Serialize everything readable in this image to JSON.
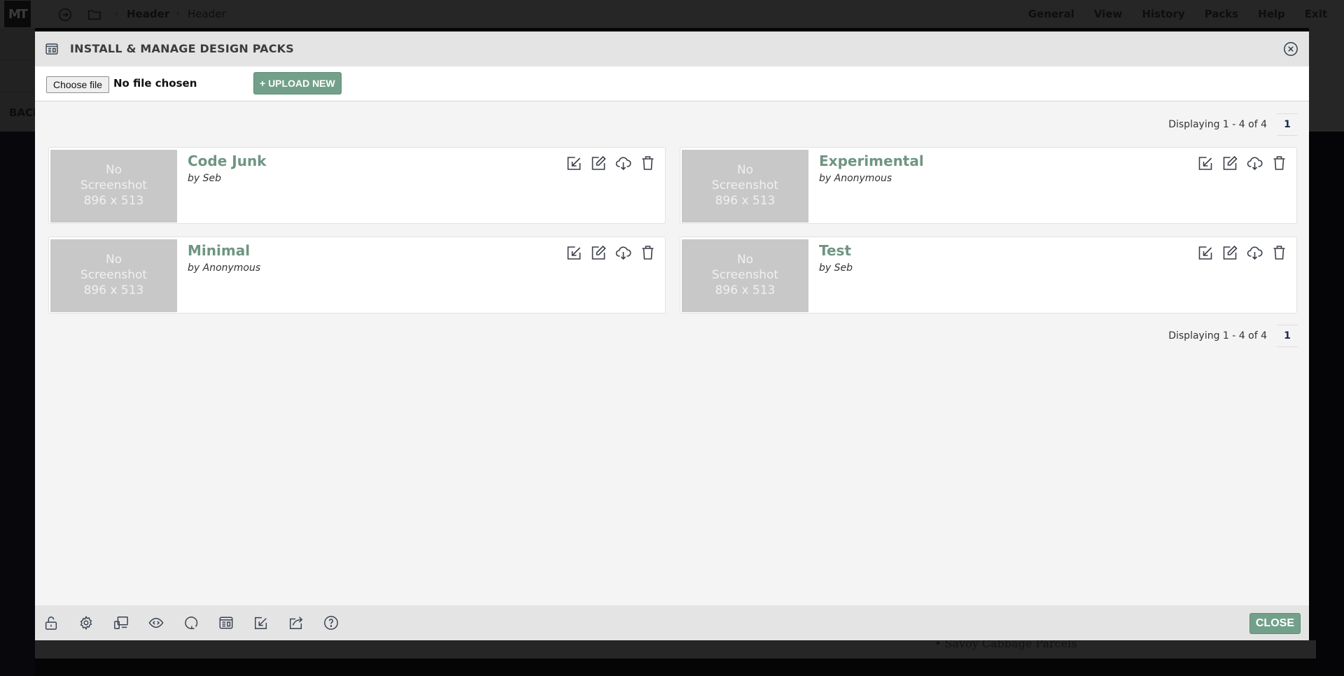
{
  "app": {
    "logo": "MT",
    "breadcrumb": [
      "Header",
      "Header"
    ],
    "menu": [
      "General",
      "View",
      "History",
      "Packs",
      "Help",
      "Exit"
    ],
    "side_label": "BACK",
    "background_list_item": "Savoy Cabbage Parcels"
  },
  "modal": {
    "title": "INSTALL & MANAGE DESIGN PACKS",
    "header_icon": "layout-panel-icon",
    "close_icon": "close-circle-icon",
    "upload": {
      "choose_file_label": "Choose file",
      "file_status": "No file chosen",
      "upload_button": "+ UPLOAD NEW"
    },
    "pagination": {
      "info": "Displaying 1 - 4 of 4",
      "current_page": "1"
    },
    "packs": [
      {
        "name": "Code Junk",
        "author": "by Seb",
        "thumb_line1": "No",
        "thumb_line2": "Screenshot",
        "thumb_line3": "896 x 513"
      },
      {
        "name": "Experimental",
        "author": "by Anonymous",
        "thumb_line1": "No",
        "thumb_line2": "Screenshot",
        "thumb_line3": "896 x 513"
      },
      {
        "name": "Minimal",
        "author": "by Anonymous",
        "thumb_line1": "No",
        "thumb_line2": "Screenshot",
        "thumb_line3": "896 x 513"
      },
      {
        "name": "Test",
        "author": "by Seb",
        "thumb_line1": "No",
        "thumb_line2": "Screenshot",
        "thumb_line3": "896 x 513"
      }
    ],
    "pack_actions": [
      "install-icon",
      "edit-icon",
      "download-cloud-icon",
      "trash-icon"
    ],
    "footer": {
      "tools": [
        "unlock-icon",
        "gear-icon",
        "devices-icon",
        "eye-code-icon",
        "refresh-icon",
        "layout-panel-icon",
        "install-icon",
        "export-icon",
        "help-icon"
      ],
      "close_button": "CLOSE"
    },
    "colors": {
      "accent": "#73a08a",
      "pack_name": "#6f9582",
      "header_bg": "#e4e4e4",
      "thumb_bg": "#c8c8c8"
    }
  }
}
